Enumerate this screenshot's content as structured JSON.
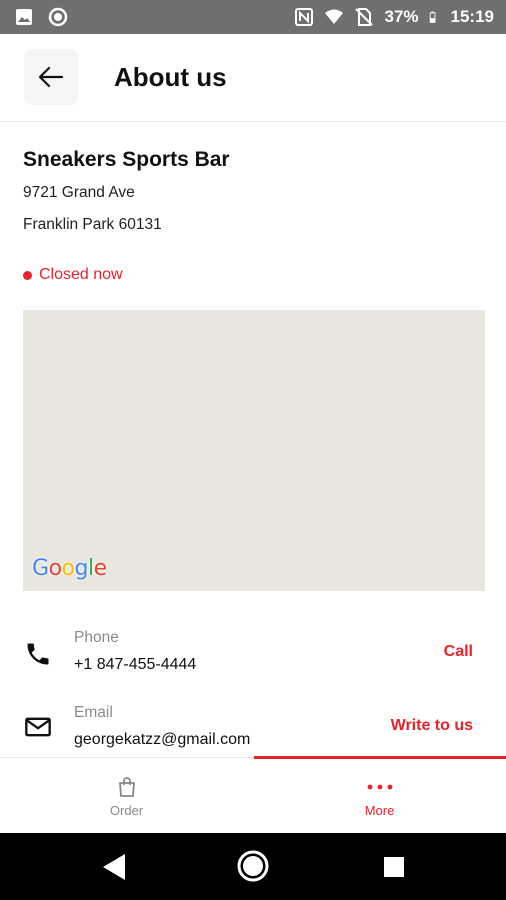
{
  "status_bar": {
    "battery": "37%",
    "time": "15:19"
  },
  "header": {
    "title": "About us",
    "back_icon": "arrow-left-icon"
  },
  "venue": {
    "name": "Sneakers Sports Bar",
    "address_line1": "9721 Grand Ave",
    "address_line2": "Franklin Park 60131",
    "status": "Closed now",
    "status_color": "#e8222a"
  },
  "map": {
    "attribution": "Google",
    "background_color": "#e9e6df"
  },
  "contacts": {
    "phone": {
      "label": "Phone",
      "value": "+1 847-455-4444",
      "action": "Call",
      "icon": "phone-icon"
    },
    "email": {
      "label": "Email",
      "value": "georgekatzz@gmail.com",
      "action": "Write to us",
      "icon": "mail-icon"
    }
  },
  "bottom_nav": {
    "items": [
      {
        "label": "Order",
        "icon": "shopping-bag-icon",
        "active": false
      },
      {
        "label": "More",
        "icon": "more-dots-icon",
        "active": true
      }
    ]
  },
  "colors": {
    "accent": "#e8222a",
    "status_bar": "#6f6f6f"
  }
}
